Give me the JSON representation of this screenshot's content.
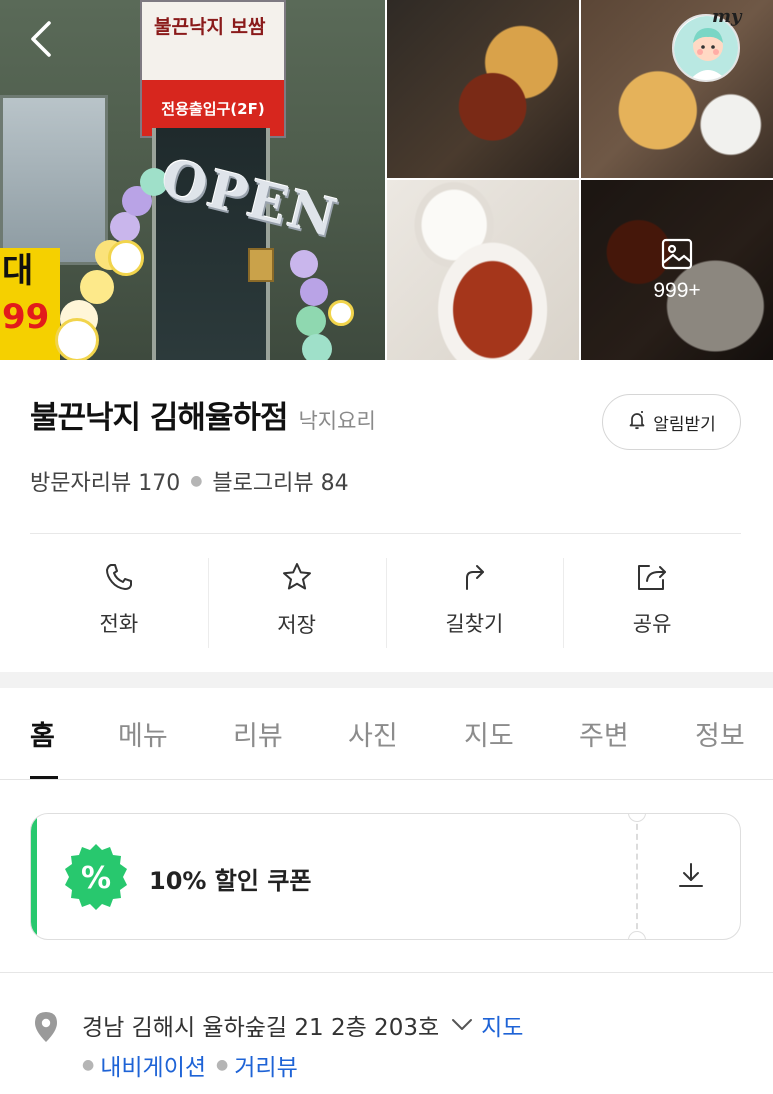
{
  "gallery": {
    "store_sign_text": "전용출입구(2F)",
    "store_logo_text": "불끈낙지 보쌈",
    "open_balloon_text": "OPEN",
    "banner_text_1": "대",
    "banner_text_2": "99",
    "photo_count": "999+",
    "my_label": "my"
  },
  "place": {
    "name": "불끈낙지 김해율하점",
    "category": "낙지요리",
    "alarm_button": "알림받기",
    "visitor_reviews": "방문자리뷰 170",
    "blog_reviews": "블로그리뷰 84"
  },
  "actions": [
    {
      "label": "전화",
      "icon": "phone-icon"
    },
    {
      "label": "저장",
      "icon": "star-icon"
    },
    {
      "label": "길찾기",
      "icon": "directions-icon"
    },
    {
      "label": "공유",
      "icon": "share-icon"
    }
  ],
  "tabs": [
    "홈",
    "메뉴",
    "리뷰",
    "사진",
    "지도",
    "주변",
    "정보"
  ],
  "active_tab": "홈",
  "coupon": {
    "badge_symbol": "%",
    "label": "10% 할인 쿠폰",
    "accent_color": "#28c86e"
  },
  "address": {
    "text": "경남 김해시 율하숲길 21 2층 203호",
    "map_link": "지도",
    "navigation_link": "내비게이션",
    "streetview_link": "거리뷰",
    "link_color": "#1e63d6"
  }
}
